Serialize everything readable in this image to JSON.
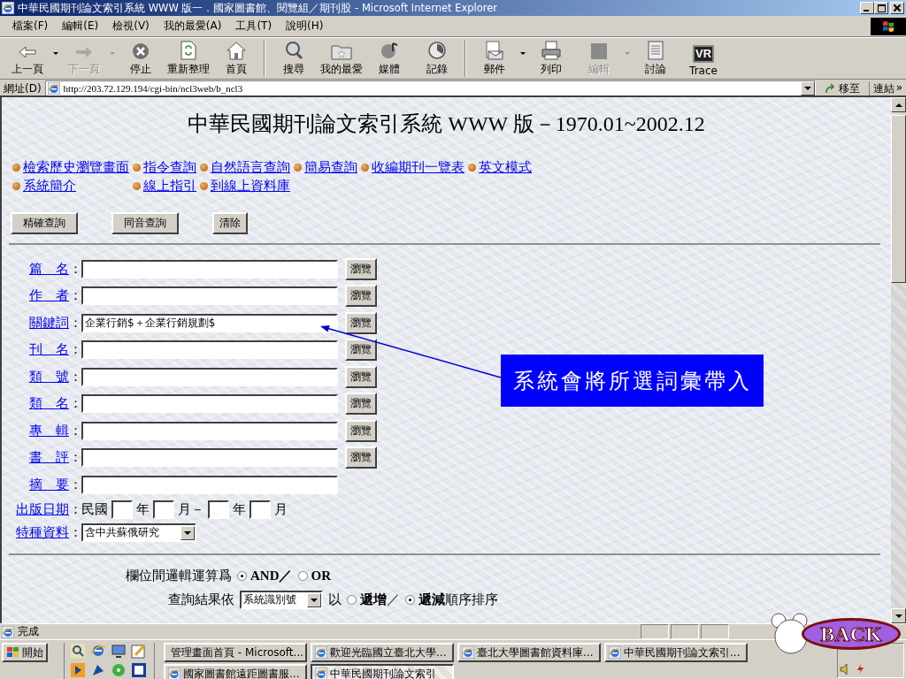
{
  "window": {
    "title": "中華民國期刊論文索引系統 WWW 版一．國家圖書館、閱覽組／期刊股 - Microsoft Internet Explorer"
  },
  "menu": [
    "檔案(F)",
    "編輯(E)",
    "檢視(V)",
    "我的最愛(A)",
    "工具(T)",
    "說明(H)"
  ],
  "toolbar": [
    {
      "label": "上一頁",
      "disabled": false,
      "dropdown": true
    },
    {
      "label": "下一頁",
      "disabled": true,
      "dropdown": true
    },
    {
      "label": "停止",
      "disabled": false,
      "dropdown": false
    },
    {
      "label": "重新整理",
      "disabled": false,
      "dropdown": false
    },
    {
      "label": "首頁",
      "disabled": false,
      "dropdown": false,
      "separator_after": true
    },
    {
      "label": "搜尋",
      "disabled": false,
      "dropdown": false
    },
    {
      "label": "我的最愛",
      "disabled": false,
      "dropdown": false
    },
    {
      "label": "媒體",
      "disabled": false,
      "dropdown": false
    },
    {
      "label": "記錄",
      "disabled": false,
      "dropdown": false,
      "separator_after": true
    },
    {
      "label": "郵件",
      "disabled": false,
      "dropdown": true
    },
    {
      "label": "列印",
      "disabled": false,
      "dropdown": false
    },
    {
      "label": "編輯",
      "disabled": true,
      "dropdown": true
    },
    {
      "label": "討論",
      "disabled": false,
      "dropdown": false
    },
    {
      "label": "Trace",
      "disabled": false,
      "dropdown": false,
      "logo_text": "VR"
    }
  ],
  "address": {
    "label": "網址(D)",
    "url": "http://203.72.129.194/cgi-bin/ncl3web/b_ncl3",
    "go": "移至",
    "links": "連結",
    "links_more": "»"
  },
  "page": {
    "title": "中華民國期刊論文索引系統 WWW 版－1970.01~2002.12",
    "links": [
      "檢索歷史瀏覽畫面",
      "指令查詢",
      "自然語言查詢",
      "簡易查詢",
      "收編期刊一覽表",
      "英文模式",
      "系統簡介",
      "線上指引",
      "到線上資料庫"
    ],
    "buttons": [
      "精確查詢",
      "同音查詢",
      "清除"
    ],
    "fields": [
      {
        "label": "篇　名",
        "separator": "：",
        "browse": "瀏覽"
      },
      {
        "label": "作　者",
        "separator": "：",
        "browse": "瀏覽"
      },
      {
        "label": "關鍵詞",
        "separator": "：",
        "value": "企業行銷$＋企業行銷規劃$",
        "browse": "瀏覽"
      },
      {
        "label": "刊　名",
        "separator": "：",
        "browse": "瀏覽"
      },
      {
        "label": "類　號",
        "separator": "：",
        "browse": "瀏覽"
      },
      {
        "label": "類　名",
        "separator": "：",
        "browse": "瀏覽"
      },
      {
        "label": "專　輯",
        "separator": "：",
        "browse": "瀏覽"
      },
      {
        "label": "書　評",
        "separator": "：",
        "browse": "瀏覽"
      },
      {
        "label": "摘　要",
        "separator": "："
      }
    ],
    "date": {
      "label": "出版日期",
      "separator": "：",
      "parts": [
        {
          "kind": "text",
          "text": "民國"
        },
        {
          "kind": "box"
        },
        {
          "kind": "text",
          "text": "年"
        },
        {
          "kind": "box"
        },
        {
          "kind": "text",
          "text": "月－"
        },
        {
          "kind": "box"
        },
        {
          "kind": "text",
          "text": "年"
        },
        {
          "kind": "box"
        },
        {
          "kind": "text",
          "text": "月"
        }
      ]
    },
    "special": {
      "label": "特種資料",
      "separator": "：",
      "value": "含中共蘇俄研究"
    },
    "logic": {
      "label": "欄位間邏輯運算爲",
      "options": [
        {
          "label": "AND／",
          "selected": true
        },
        {
          "label": "OR",
          "selected": false
        }
      ]
    },
    "sort": {
      "label": "查詢結果依",
      "value": "系統識別號",
      "prefix": "以",
      "options": [
        {
          "label": "**遞增**／",
          "selected": false
        },
        {
          "label": "**遞減**順序排序",
          "selected": true
        }
      ]
    },
    "callout": "系統會將所選詞彙帶入"
  },
  "status_bar": {
    "text": "完成"
  },
  "taskbar": {
    "start": "開始",
    "tasks": [
      {
        "label": "管理畫面首頁 - Microsoft...",
        "selected": false
      },
      {
        "label": "歡迎光臨國立臺北大學...",
        "selected": false
      },
      {
        "label": "臺北大學圖書館資料庫...",
        "selected": false
      },
      {
        "label": "中華民國期刊論文索引...",
        "selected": false
      },
      {
        "label": "國家圖書館遠距圖書服...",
        "selected": false
      },
      {
        "label": "中華民國期刊論文索引",
        "selected": true
      }
    ]
  },
  "overlay": {
    "back": "BACK"
  }
}
